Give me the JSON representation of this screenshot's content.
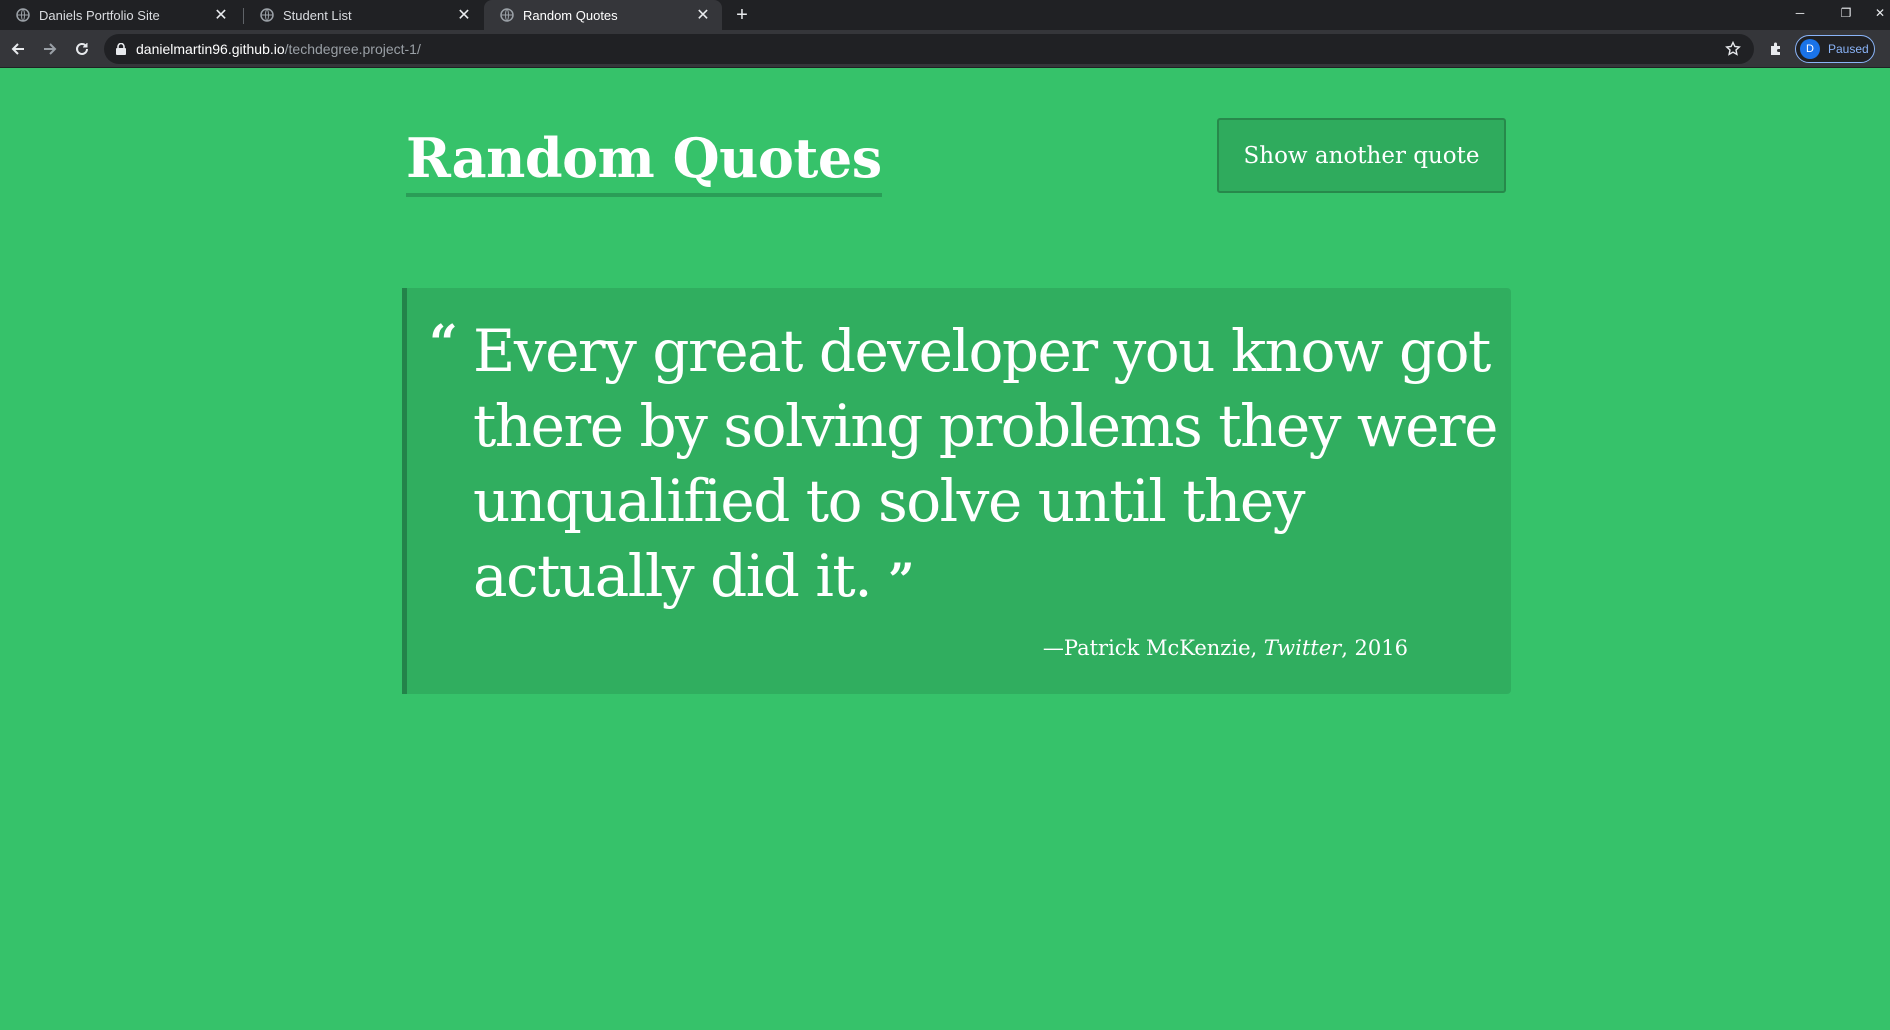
{
  "browser": {
    "tabs": [
      {
        "title": "Daniels Portfolio Site",
        "active": false
      },
      {
        "title": "Student List",
        "active": false
      },
      {
        "title": "Random Quotes",
        "active": true
      }
    ],
    "new_tab_icon": "plus-icon",
    "window_controls": [
      "minimize-icon",
      "restore-icon",
      "close-icon"
    ],
    "address": {
      "host": "danielmartin96.github.io",
      "path": "/techdegree.project-1/"
    },
    "profile": {
      "initial": "D",
      "status": "Paused"
    }
  },
  "page": {
    "background_color": "#36c26a",
    "title": "Random Quotes",
    "button_label": "Show another quote",
    "quote": {
      "open_mark": "“",
      "text": "Every great developer you know got there by solving problems they were unqualified to solve until they actually did it.",
      "close_mark": "”",
      "dash": "—",
      "author": "Patrick McKenzie",
      "sep1": ", ",
      "source": "Twitter",
      "sep2": ", ",
      "year": "2016"
    }
  }
}
